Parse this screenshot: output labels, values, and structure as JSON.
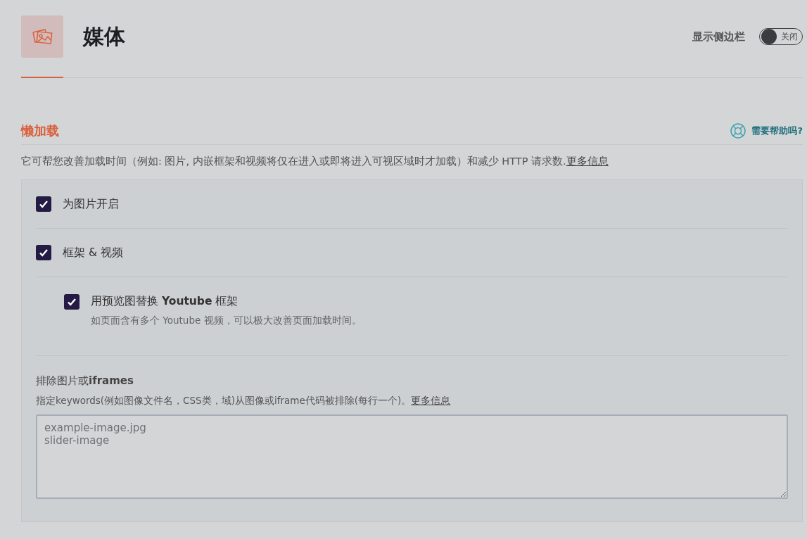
{
  "header": {
    "title": "媒体",
    "sidebar_toggle": {
      "label": "显示侧边栏",
      "on": false,
      "state_text": "关闭"
    }
  },
  "section": {
    "title": "懒加载",
    "help": "需要帮助吗?",
    "description": "它可帮您改善加载时间（例如: 图片, 内嵌框架和视频将仅在进入或即将进入可视区域时才加载）和减少 HTTP 请求数.",
    "description_link": "更多信息"
  },
  "options": [
    {
      "label": "为图片开启",
      "checked": true
    },
    {
      "label": "框架 & 视频",
      "checked": true,
      "children": [
        {
          "label": "用预览图替换 **Youtube** 框架",
          "hint": "如页面含有多个 Youtube 视频，可以极大改善页面加载时间。",
          "checked": true
        }
      ]
    }
  ],
  "exclusions": {
    "title": "排除图片或**iframes**",
    "description": "指定keywords(例如图像文件名，CSS类，域)从图像或iframe代码被排除(每行一个)。",
    "link": "更多信息",
    "placeholder": "example-image.jpg\nslider-image"
  }
}
